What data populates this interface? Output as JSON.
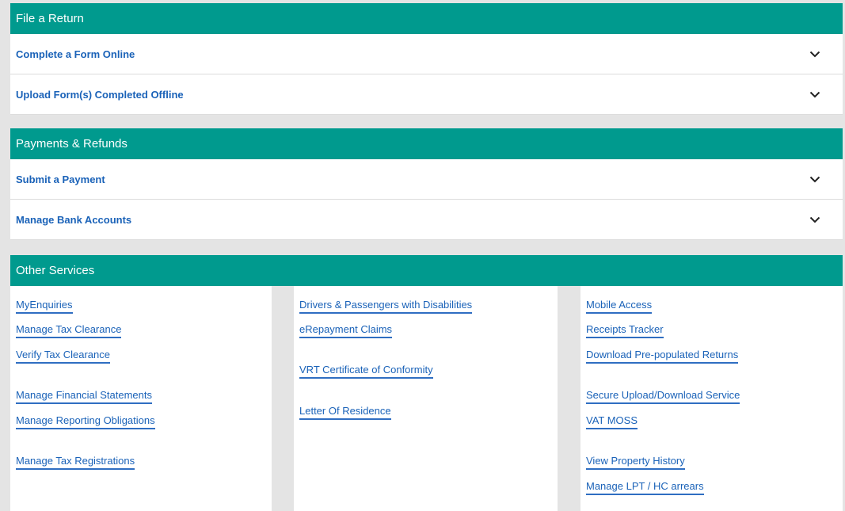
{
  "file_return": {
    "header": "File a Return",
    "items": [
      {
        "label": "Complete a Form Online"
      },
      {
        "label": "Upload Form(s) Completed Offline"
      }
    ]
  },
  "payments": {
    "header": "Payments & Refunds",
    "items": [
      {
        "label": "Submit a Payment"
      },
      {
        "label": "Manage Bank Accounts"
      }
    ]
  },
  "other_services": {
    "header": "Other Services",
    "col1": [
      "MyEnquiries",
      "Manage Tax Clearance",
      "Verify Tax Clearance",
      "Manage Financial Statements",
      "Manage Reporting Obligations",
      "Manage Tax Registrations"
    ],
    "col2": [
      "Drivers & Passengers with Disabilities",
      "eRepayment Claims",
      "VRT Certificate of Conformity",
      "Letter Of Residence"
    ],
    "col3": [
      "Mobile Access",
      "Receipts Tracker",
      "Download Pre-populated Returns",
      "Secure Upload/Download Service",
      "VAT MOSS",
      "View Property History",
      "Manage LPT / HC arrears"
    ]
  },
  "colors": {
    "header_bg": "#009a8e",
    "link": "#1a62b8",
    "page_bg": "#e4e4e4"
  }
}
